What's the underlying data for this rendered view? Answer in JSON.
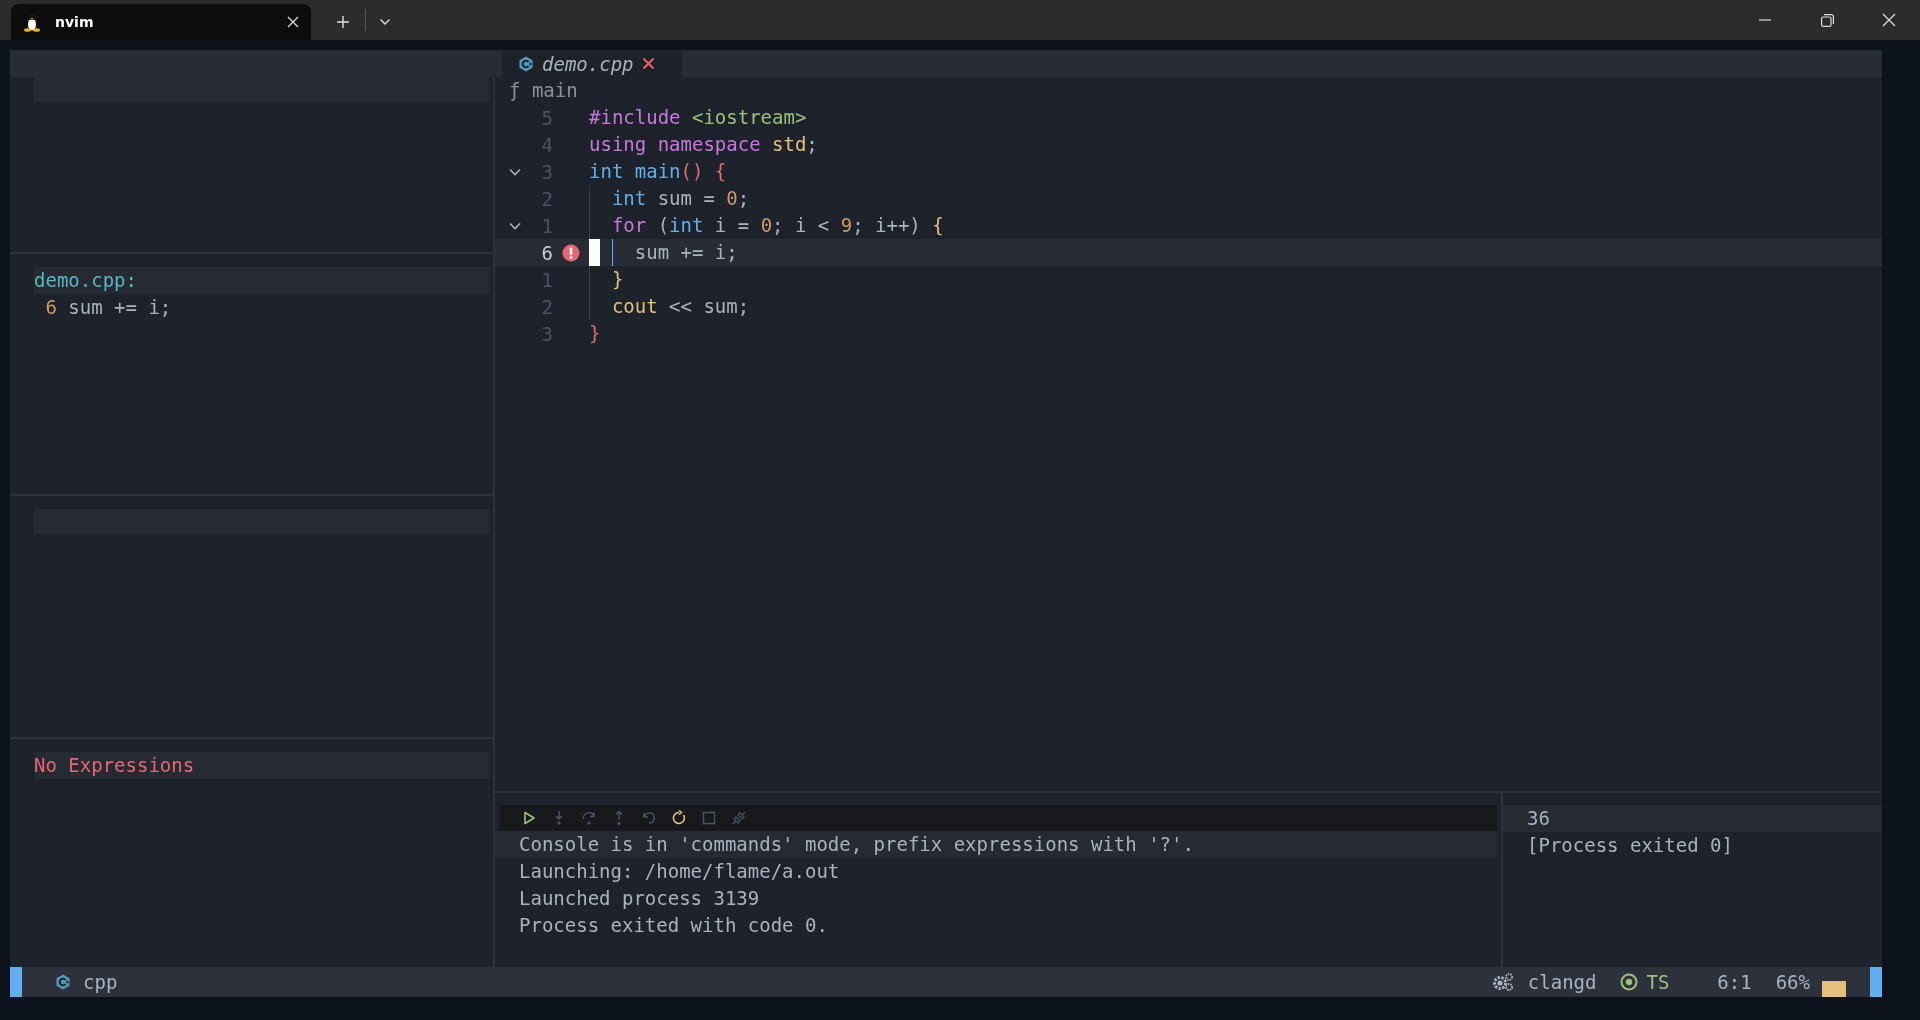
{
  "window": {
    "tab_title": "nvim"
  },
  "editor": {
    "tab": {
      "filename": "demo.cpp"
    },
    "winbar": {
      "symbol": "ƒ",
      "name": "main"
    },
    "lines": [
      {
        "number": "5",
        "selected": false,
        "cursor": false,
        "error": false,
        "tokens": [
          {
            "kind": "preproc",
            "text": "#include"
          },
          {
            "kind": "string",
            "text": " <iostream>"
          }
        ]
      },
      {
        "number": "4",
        "selected": false,
        "cursor": false,
        "error": false,
        "tokens": [
          {
            "kind": "keyword",
            "text": "using namespace"
          },
          {
            "kind": "namespace",
            "text": " std"
          },
          {
            "kind": "plain",
            "text": ";"
          }
        ]
      },
      {
        "number": "3",
        "selected": false,
        "cursor": false,
        "error": false,
        "expanded": true,
        "tokens": [
          {
            "kind": "type",
            "text": "int"
          },
          {
            "kind": "function",
            "text": " main"
          },
          {
            "kind": "bracket_outer",
            "text": "() {"
          }
        ]
      },
      {
        "number": "2",
        "selected": false,
        "cursor": false,
        "error": false,
        "tokens": [
          {
            "kind": "type",
            "text": "  int"
          },
          {
            "kind": "plain",
            "text": " sum = "
          },
          {
            "kind": "number",
            "text": "0"
          },
          {
            "kind": "plain",
            "text": ";"
          }
        ]
      },
      {
        "number": "1",
        "selected": false,
        "cursor": false,
        "error": false,
        "expanded": true,
        "tokens": [
          {
            "kind": "keyword",
            "text": "  for"
          },
          {
            "kind": "plain",
            "text": " ("
          },
          {
            "kind": "type",
            "text": "int"
          },
          {
            "kind": "plain",
            "text": " i = "
          },
          {
            "kind": "number",
            "text": "0"
          },
          {
            "kind": "plain",
            "text": "; i < "
          },
          {
            "kind": "number",
            "text": "9"
          },
          {
            "kind": "plain",
            "text": "; i++) "
          },
          {
            "kind": "bracket_inner",
            "text": "{"
          }
        ]
      },
      {
        "number": "6",
        "selected": true,
        "cursor": true,
        "error": true,
        "tokens": [
          {
            "kind": "plain",
            "text": "    sum += i;"
          }
        ]
      },
      {
        "number": "1",
        "selected": false,
        "cursor": false,
        "error": false,
        "tokens": [
          {
            "kind": "bracket_inner",
            "text": "  }"
          }
        ]
      },
      {
        "number": "2",
        "selected": false,
        "cursor": false,
        "error": false,
        "tokens": [
          {
            "kind": "builtin",
            "text": "  cout"
          },
          {
            "kind": "plain",
            "text": " << sum;"
          }
        ]
      },
      {
        "number": "3",
        "selected": false,
        "cursor": false,
        "error": false,
        "tokens": [
          {
            "kind": "bracket_outer",
            "text": "}"
          }
        ]
      }
    ]
  },
  "breakpoints": {
    "file": "demo.cpp:",
    "entries": [
      {
        "line": "6",
        "text": "sum += i;"
      }
    ]
  },
  "watches": {
    "message": "No Expressions"
  },
  "console": {
    "controls": [
      {
        "kind": "play",
        "disabled": false
      },
      {
        "kind": "step_into",
        "disabled": true
      },
      {
        "kind": "step_over",
        "disabled": true
      },
      {
        "kind": "step_out",
        "disabled": true
      },
      {
        "kind": "step_back",
        "disabled": true
      },
      {
        "kind": "restart",
        "disabled": false
      },
      {
        "kind": "stop",
        "disabled": true
      },
      {
        "kind": "disconnect",
        "disabled": true
      }
    ],
    "lines": [
      "Console is in 'commands' mode, prefix expressions with '?'.",
      "Launching: /home/flame/a.out",
      "Launched process 3139",
      "Process exited with code 0."
    ]
  },
  "terminal": {
    "lines": [
      "36",
      "[Process exited 0]"
    ]
  },
  "status_bar": {
    "filetype": "cpp",
    "lsp": "clangd",
    "treesitter": "TS",
    "position": "6:1",
    "percent": "66%"
  }
}
